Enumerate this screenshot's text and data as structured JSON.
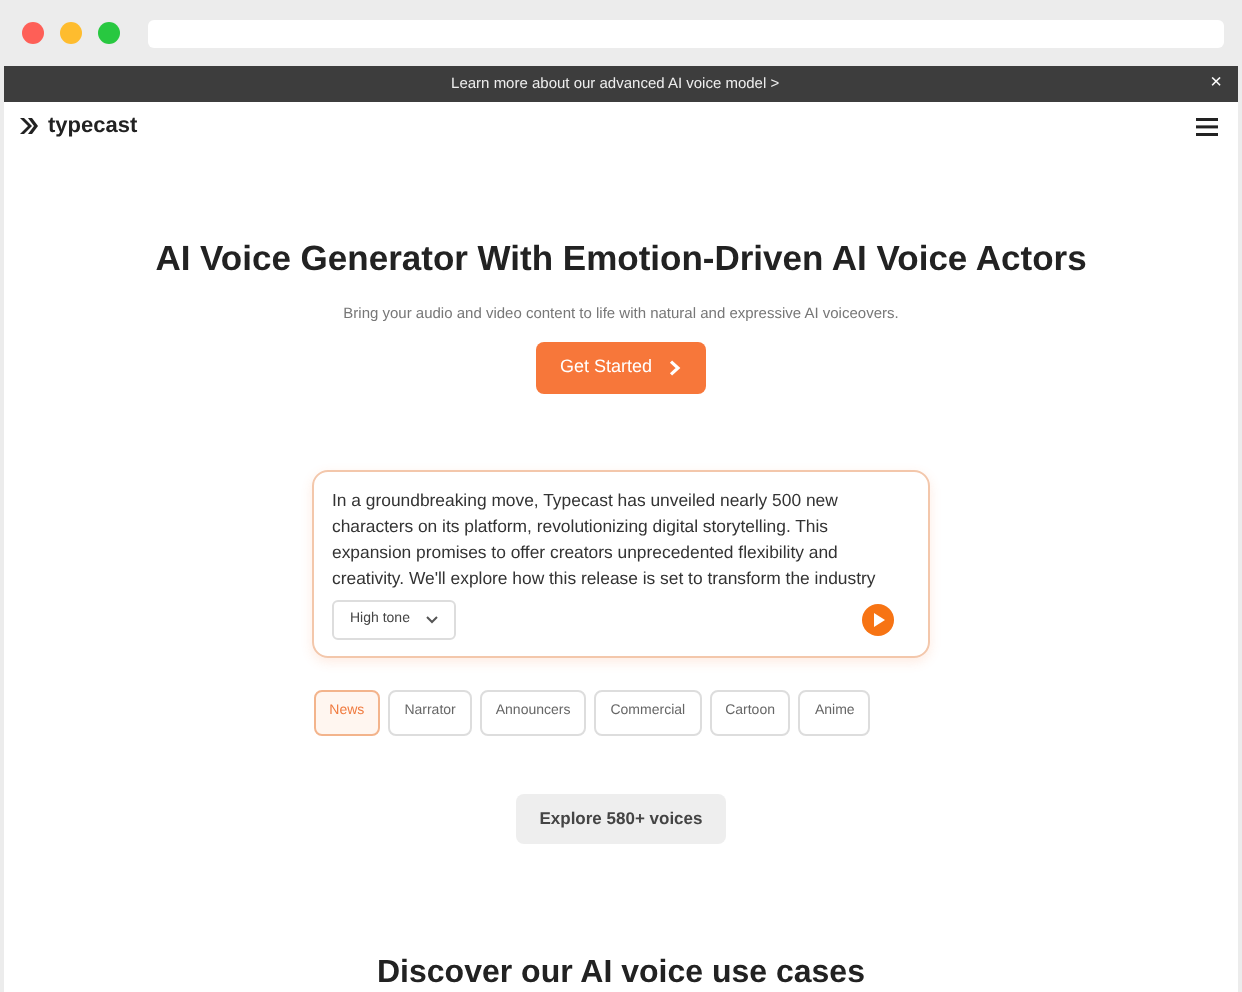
{
  "announcement": {
    "text": "Learn more about our advanced AI voice model >",
    "close": "×"
  },
  "navbar": {
    "logo": "typecast"
  },
  "hero": {
    "title": "AI Voice Generator With Emotion-Driven AI Voice Actors",
    "subtitle": "Bring your audio and video content to life with natural and expressive AI voiceovers.",
    "cta": "Get Started"
  },
  "demo": {
    "text": "In a groundbreaking move, Typecast has unveiled nearly 500 new characters on its platform, revolutionizing digital storytelling. This expansion promises to offer creators unprecedented flexibility and creativity. We'll explore how this release is set to transform the industry",
    "tone": "High tone"
  },
  "categories": [
    {
      "label": "News",
      "selected": true
    },
    {
      "label": "Narrator",
      "selected": false
    },
    {
      "label": "Announcers",
      "selected": false
    },
    {
      "label": "Commercial",
      "selected": false
    },
    {
      "label": "Cartoon",
      "selected": false
    },
    {
      "label": "Anime",
      "selected": false
    }
  ],
  "explore_button": "Explore 580+ voices",
  "section_title": "Discover our AI voice use cases"
}
